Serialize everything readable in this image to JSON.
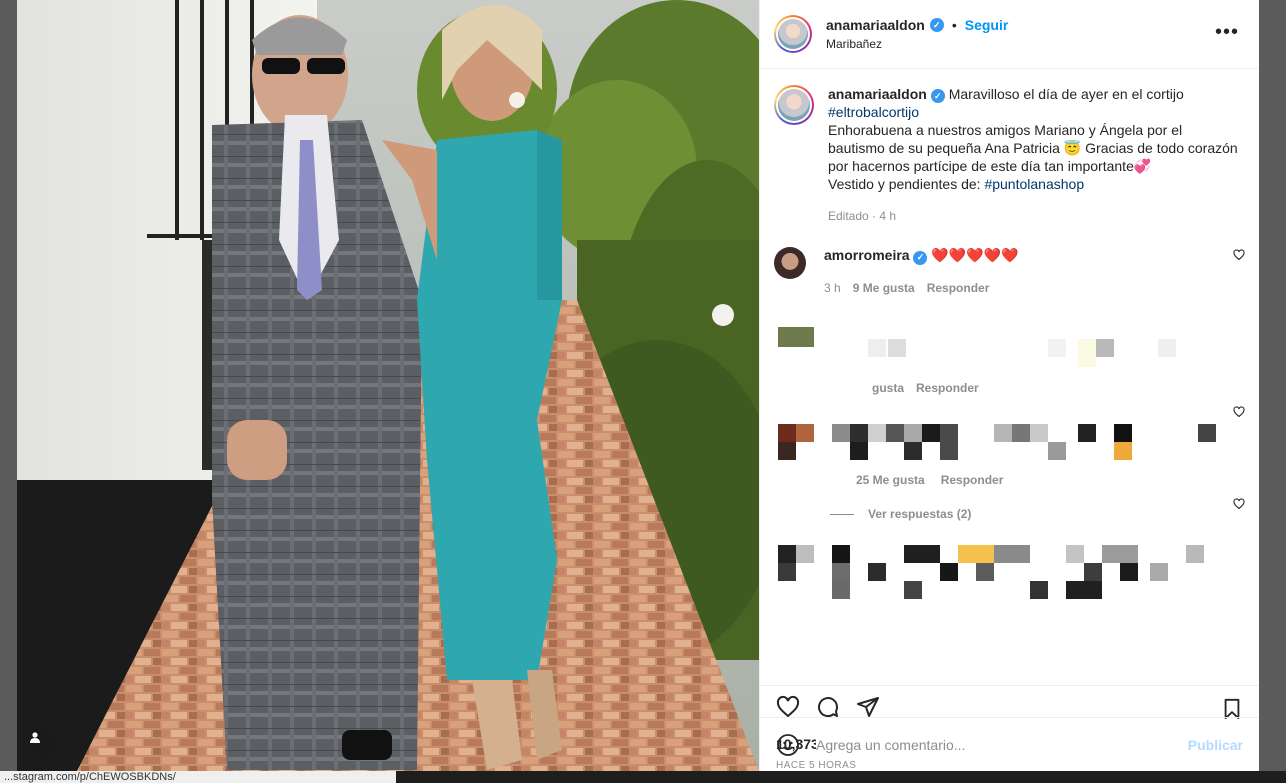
{
  "post": {
    "username": "anamariaaldon",
    "location": "Maribañez",
    "follow_label": "Seguir",
    "more_label": "•••",
    "caption": {
      "text_1": "Maravilloso el día de ayer en el cortijo",
      "hashtag_1": "#eltrobalcortijo",
      "text_2": "Enhorabuena a nuestros amigos Mariano y Ángela por el bautismo de su pequeña Ana Patricia 😇 Gracias de todo corazón por hacernos partícipe de este día tan importante💞",
      "text_3": "Vestido y pendientes de: ",
      "hashtag_2": "#puntolanashop",
      "meta": "Editado · 4 h"
    },
    "likes": "10,373 Me gusta",
    "time_ago": "HACE 5 HORAS"
  },
  "comments": [
    {
      "username": "amorromeira",
      "text": "❤️❤️❤️❤️❤️",
      "time": "3 h",
      "likes": "9 Me gusta",
      "reply": "Responder"
    },
    {
      "likes_fragment": "gusta",
      "reply": "Responder"
    },
    {
      "likes": "25 Me gusta",
      "reply": "Responder",
      "view_replies": "Ver respuestas (2)"
    }
  ],
  "comment_box": {
    "placeholder": "Agrega un comentario...",
    "publish_label": "Publicar"
  },
  "status_url": "...stagram.com/p/ChEWOSBKDNs/",
  "colors": {
    "link": "#0095f6",
    "hashtag": "#00376b",
    "muted": "#8e8e8e",
    "dress": "#2fa7ae"
  }
}
